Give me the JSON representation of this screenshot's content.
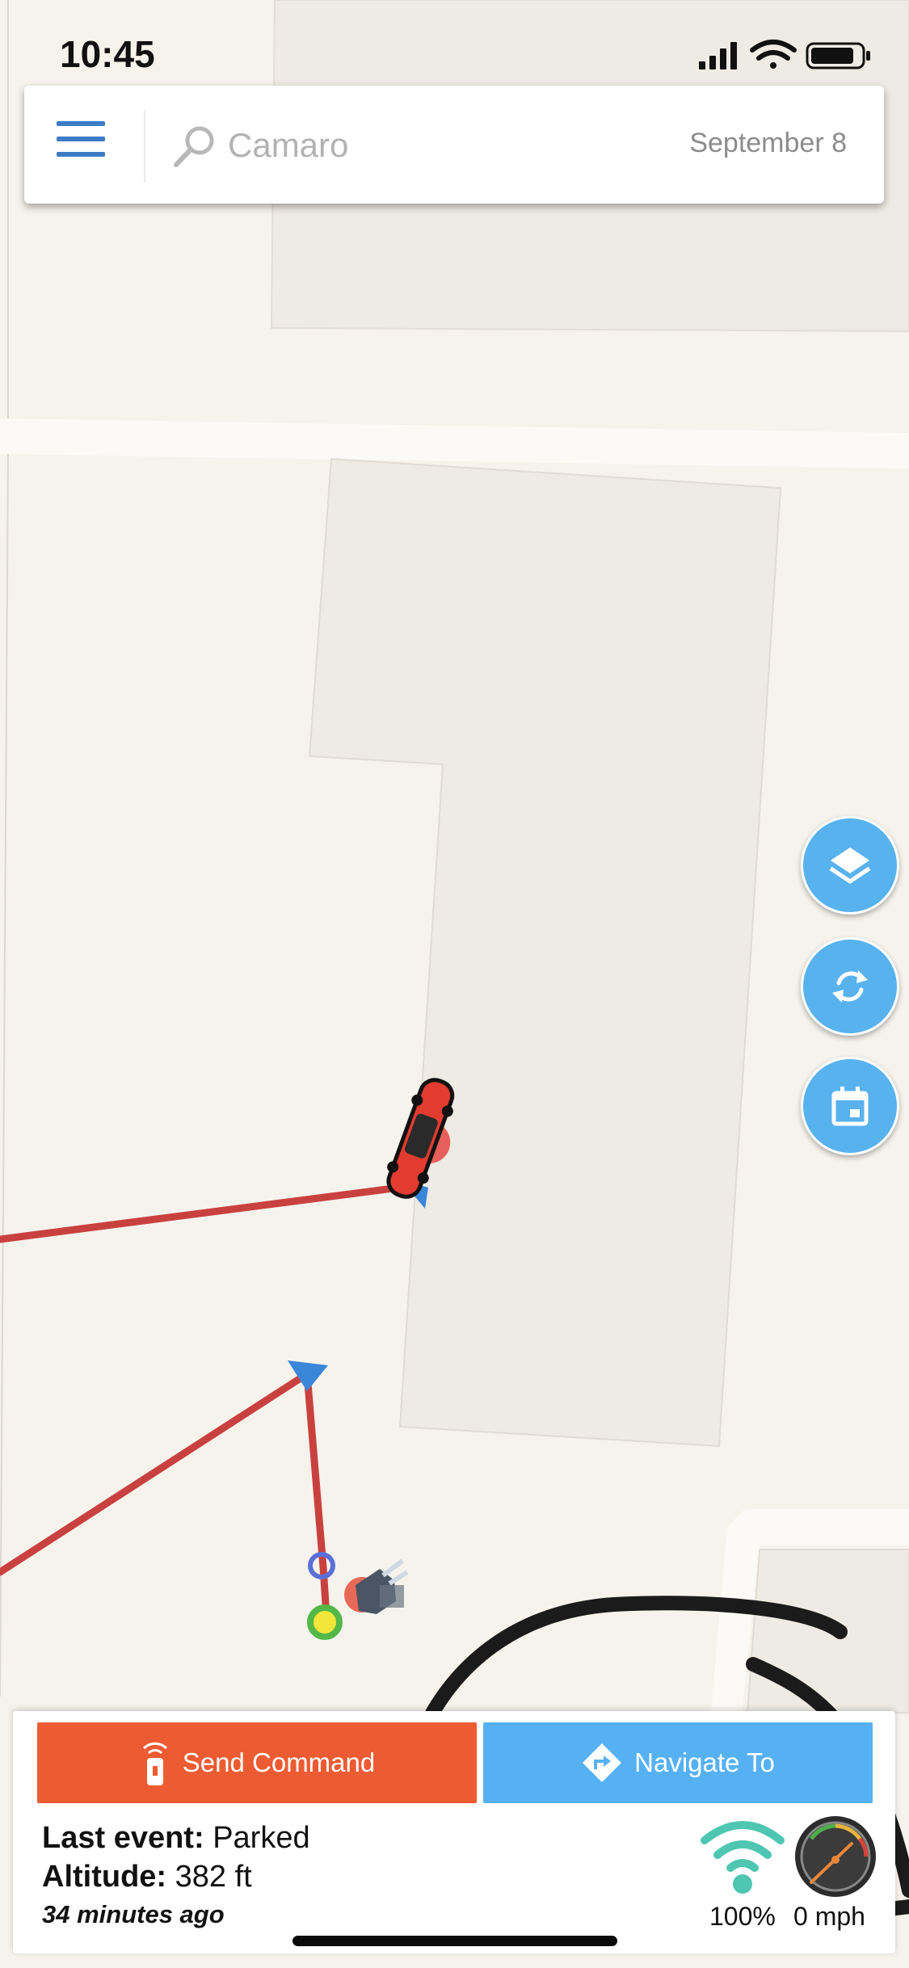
{
  "status_bar": {
    "time": "10:45"
  },
  "header": {
    "search_placeholder": "Camaro",
    "date": "September 8"
  },
  "vehicle_panel": {
    "send_command_label": "Send Command",
    "navigate_label": "Navigate To",
    "last_event_label": "Last event:",
    "last_event_value": "Parked",
    "altitude_label": "Altitude:",
    "altitude_value": "382 ft",
    "time_ago": "34 minutes ago",
    "signal_text": "100%",
    "speed_text": "0 mph"
  },
  "colors": {
    "accent_blue": "#58b2ee",
    "command_orange": "#ec5b32",
    "route_red": "#c8413f",
    "map_background": "#f6f3ec",
    "building": "#eeebe4",
    "signal_teal": "#4fc6b2"
  },
  "icons": [
    "hamburger-menu-icon",
    "search-icon",
    "layers-icon",
    "refresh-icon",
    "calendar-icon",
    "remote-icon",
    "directions-icon",
    "wifi-signal-icon",
    "speedometer-icon",
    "car-marker-icon",
    "plug-icon"
  ]
}
